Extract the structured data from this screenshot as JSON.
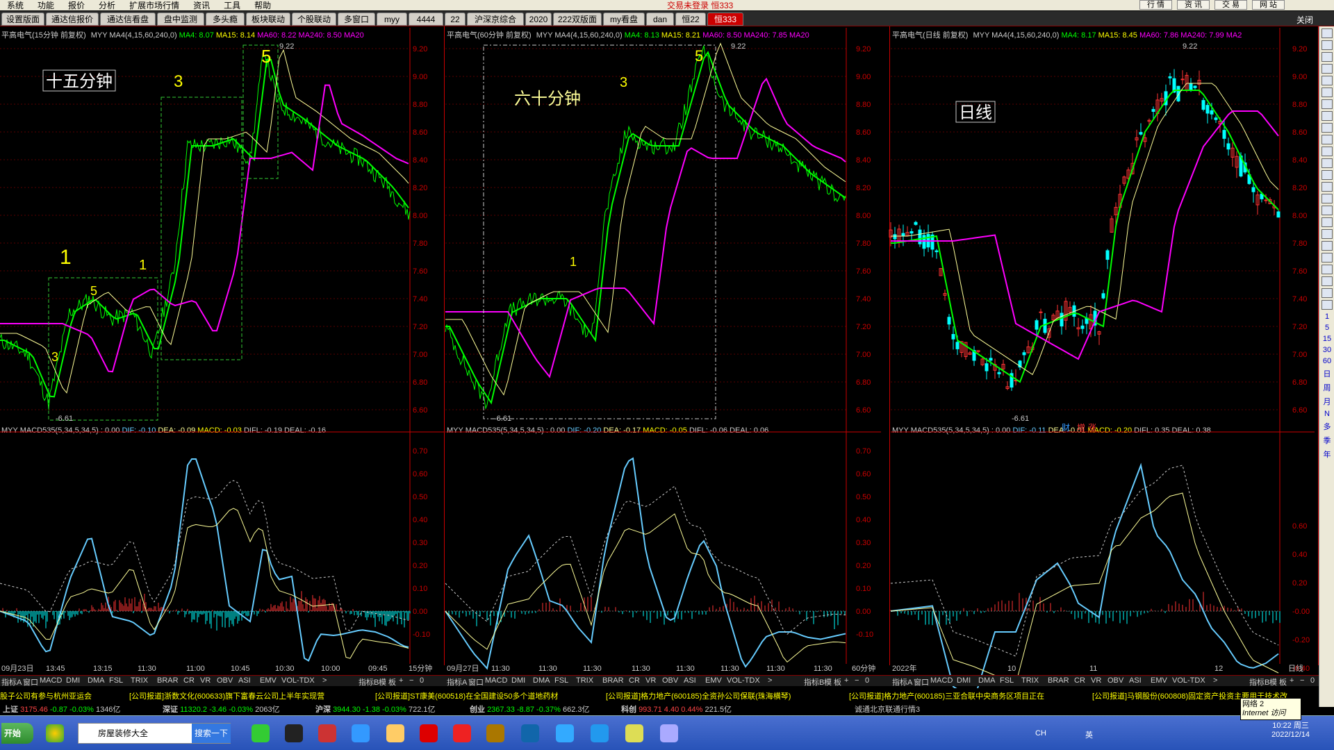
{
  "menubar": {
    "items": [
      "系统",
      "功能",
      "报价",
      "分析",
      "扩展市场行情",
      "资讯",
      "工具",
      "帮助"
    ],
    "center_title": "交易未登录 恒333",
    "right_buttons": [
      "行 情",
      "资 讯",
      "交 易",
      "网 站"
    ]
  },
  "tabs": {
    "items": [
      "设置版面",
      "通达信报价",
      "通达信看盘",
      "盘中监测",
      "多头瘾",
      "板块联动",
      "个股联动",
      "多窗口",
      "myy",
      "4444",
      "22",
      "沪深京综合",
      "2020",
      "222双版面",
      "my看盘",
      "dan",
      "恒22",
      "恒333"
    ],
    "active": "恒333",
    "close_label": "关闭"
  },
  "panels": [
    {
      "title_prefix": "平高电气(15分钟 前复权)",
      "ma_formula": "MYY MA4(4,15,60,240,0)",
      "ma4": "MA4: 8.07",
      "ma15": "MA15: 8.14",
      "ma60": "MA60: 8.22",
      "ma240": "MA240: 8.50",
      "ma_more": "MA20",
      "annotation": "十五分钟",
      "high_label": "9.22",
      "low_label": "6.61",
      "wave_labels": [
        "1",
        "3",
        "5",
        "1",
        "3",
        "5"
      ],
      "macd_formula": "MYY MACD535(5,34,5,34,5) : 0.00",
      "dif": "DIF: -0.10",
      "dea": "DEA: -0.09",
      "macd": "MACD: -0.03",
      "difl": "DIFL: -0.19",
      "deal": "DEAL: -0.16",
      "time_labels": [
        "09月23日",
        "13:45",
        "13:15",
        "11:30",
        "11:00",
        "10:45",
        "10:30",
        "10:00",
        "09:45"
      ],
      "period": "15分钟",
      "indicator_tabs": [
        "指标A",
        "窗口",
        "MACD",
        "DMI",
        "DMA",
        "FSL",
        "TRIX",
        "BRAR",
        "CR",
        "VR",
        "OBV",
        "ASI",
        "EMV",
        "VOL-TDX",
        ">"
      ],
      "indicator_right": [
        "指标B",
        "模 板",
        "+",
        "−",
        "0"
      ]
    },
    {
      "title_prefix": "平高电气(60分钟 前复权)",
      "ma_formula": "MYY MA4(4,15,60,240,0)",
      "ma4": "MA4: 8.13",
      "ma15": "MA15: 8.21",
      "ma60": "MA60: 8.50",
      "ma240": "MA240: 7.85",
      "ma_more": "MA20",
      "annotation": "六十分钟",
      "high_label": "9.22",
      "low_label": "6.61",
      "wave_labels": [
        "1",
        "3",
        "5"
      ],
      "macd_formula": "MYY MACD535(5,34,5,34,5) : 0.00",
      "dif": "DIF: -0.20",
      "dea": "DEA: -0.17",
      "macd": "MACD: -0.05",
      "difl": "DIFL: -0.06",
      "deal": "DEAL: 0.06",
      "time_labels": [
        "09月27日",
        "11:30",
        "11:30",
        "11:30",
        "11:30",
        "11:30",
        "11:30",
        "11:30",
        "11:30"
      ],
      "period": "60分钟",
      "indicator_tabs": [
        "指标A",
        "窗口",
        "MACD",
        "DMI",
        "DMA",
        "FSL",
        "TRIX",
        "BRAR",
        "CR",
        "VR",
        "OBV",
        "ASI",
        "EMV",
        "VOL-TDX",
        ">"
      ],
      "indicator_right": [
        "指标B",
        "模 板",
        "+",
        "−",
        "0"
      ]
    },
    {
      "title_prefix": "平高电气(日线 前复权)",
      "ma_formula": "MYY MA4(4,15,60,240,0)",
      "ma4": "MA4: 8.17",
      "ma15": "MA15: 8.45",
      "ma60": "MA60: 7.86",
      "ma240": "MA240: 7.99",
      "ma_more": "MA2",
      "annotation": "日线",
      "high_label": "9.22",
      "low_label": "6.61",
      "badges": [
        "财",
        "增",
        "涨"
      ],
      "macd_formula": "MYY MACD535(5,34,5,34,5) : 0.00",
      "dif": "DIF: -0.11",
      "dea": "DEA: -0.01",
      "macd": "MACD: -0.20",
      "difl": "DIFL: 0.35",
      "deal": "DEAL: 0.38",
      "time_labels": [
        "2022年",
        "10",
        "11",
        "12"
      ],
      "period": "日线",
      "indicator_tabs": [
        "指标A",
        "窗口",
        "MACD",
        "DMI",
        "DMA",
        "FSL",
        "TRIX",
        "BRAR",
        "CR",
        "VR",
        "OBV",
        "ASI",
        "EMV",
        "VOL-TDX",
        ">"
      ],
      "indicator_right": [
        "指标B",
        "模 板",
        "+",
        "−",
        "0"
      ]
    }
  ],
  "price_axis": [
    "9.20",
    "9.00",
    "8.80",
    "8.60",
    "8.40",
    "8.20",
    "8.00",
    "7.80",
    "7.60",
    "7.40",
    "7.20",
    "7.00",
    "6.80",
    "6.60"
  ],
  "macd_axis_1": [
    "0.70",
    "0.60",
    "0.50",
    "0.40",
    "0.30",
    "0.20",
    "0.10",
    "0.00",
    "-0.10"
  ],
  "macd_axis_3": [
    "0.60",
    "0.40",
    "0.20",
    "-0.00",
    "-0.20",
    "-0.40"
  ],
  "rightbar_labels": [
    "1",
    "5",
    "15",
    "30",
    "60",
    "日",
    "周",
    "月",
    "N",
    "多",
    "季",
    "年"
  ],
  "news": [
    "股子公司有参与杭州亚运会",
    "[公司报道]浙数文化(600633)旗下富春云公司上半年实现营",
    "[公司报道]ST康美(600518)在全国建设50多个道地药材",
    "[公司报道]格力地产(600185)全资孙公司保联(珠海横琴)",
    "[公司报道]格力地产(600185)三亚合联中央商务区项目正在",
    "[公司报道]马钢股份(600808)固定资产投资主要用于技术改"
  ],
  "indices": [
    {
      "name": "上证",
      "value": "3175.46",
      "chg": "-0.87",
      "pct": "-0.03%",
      "amt": "1346亿"
    },
    {
      "name": "深证",
      "value": "11320.2",
      "chg": "-3.46",
      "pct": "-0.03%",
      "amt": "2063亿"
    },
    {
      "name": "沪深",
      "value": "3944.30",
      "chg": "-1.38",
      "pct": "-0.03%",
      "amt": "722.1亿"
    },
    {
      "name": "创业",
      "value": "2367.33",
      "chg": "-8.87",
      "pct": "-0.37%",
      "amt": "662.3亿"
    },
    {
      "name": "科创",
      "value": "993.71",
      "chg": "4.40",
      "pct": "0.44%",
      "amt": "221.5亿"
    }
  ],
  "server": "诚通北京联通行情3",
  "taskbar": {
    "start": "开始",
    "search_text": "房屋装修大全",
    "search_button": "搜索一下",
    "tray_text": "CH",
    "ime": "英",
    "time": "10:22 周三",
    "date": "2022/12/14"
  },
  "net_popup": {
    "line1": "网络 2",
    "line2": "Internet 访问"
  },
  "colors": {
    "up": "#ff3333",
    "down": "#00ffff",
    "ma4": "#00ff00",
    "ma15": "#ffff99",
    "ma60": "#ff00ff",
    "ma240": "#ff00ff",
    "border": "#cc0000"
  }
}
